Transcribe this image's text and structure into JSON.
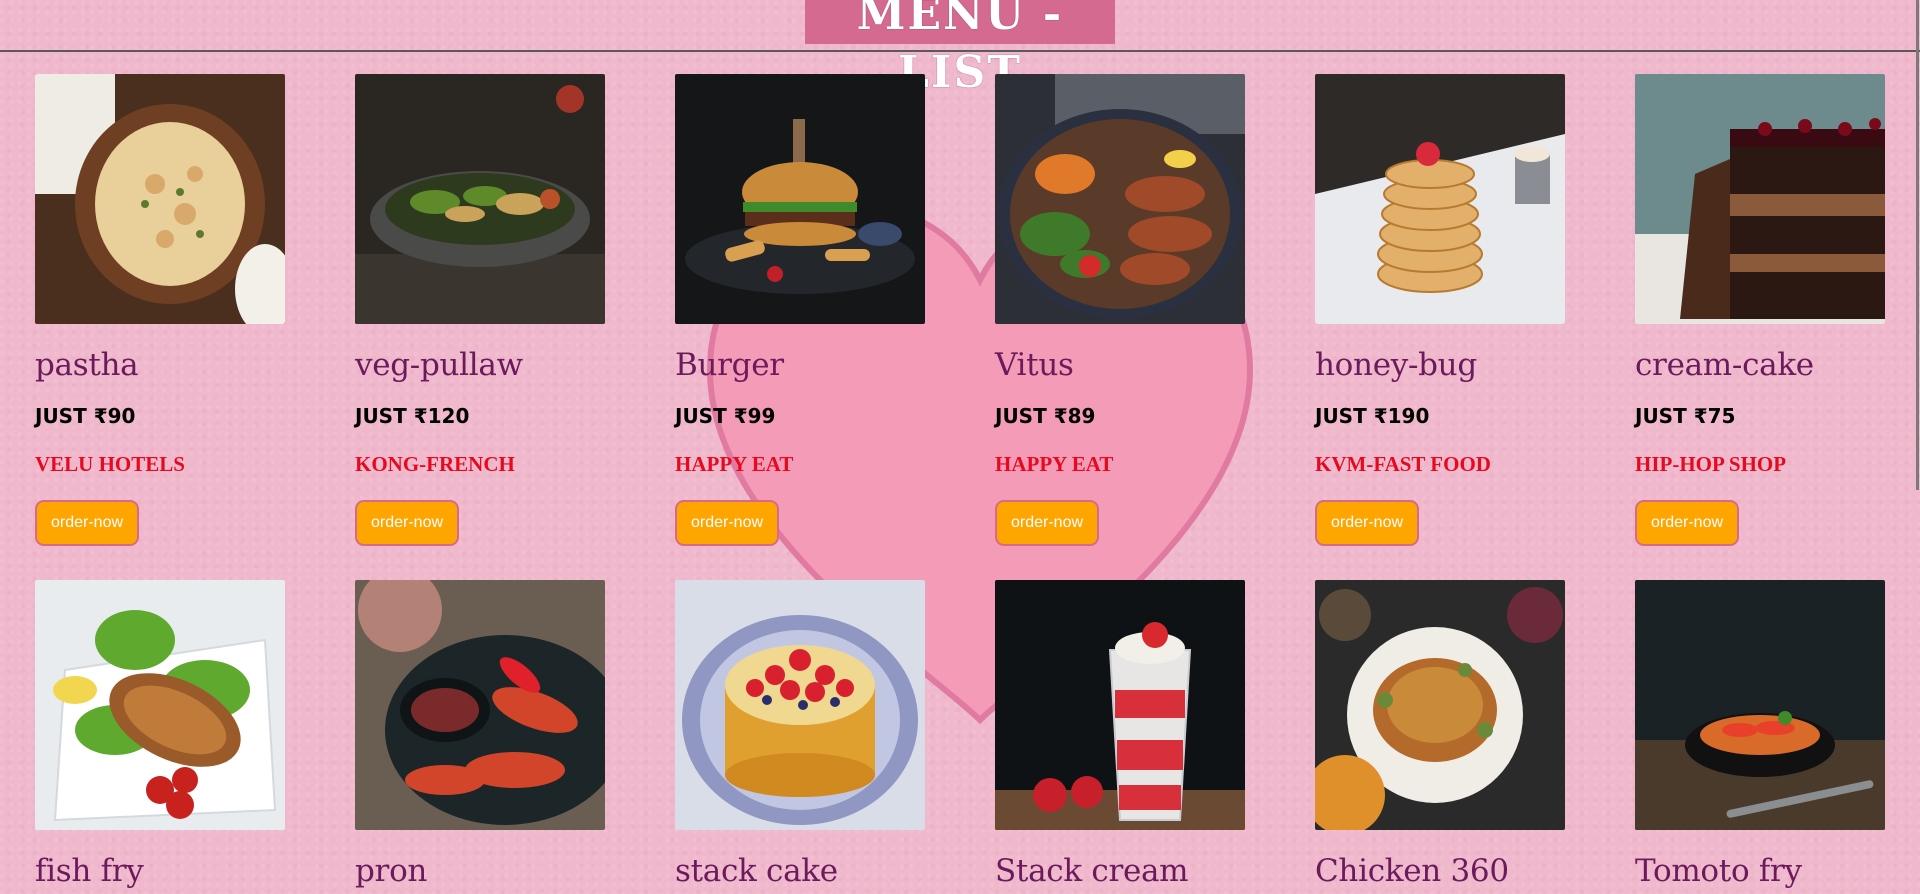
{
  "header": {
    "title": "MENU - LIST"
  },
  "menu": {
    "items": [
      {
        "name": "pastha",
        "price": "JUST ₹90",
        "shop": "VELU HOTELS",
        "button": "order-now"
      },
      {
        "name": "veg-pullaw",
        "price": "JUST ₹120",
        "shop": "KONG-FRENCH",
        "button": "order-now"
      },
      {
        "name": "Burger",
        "price": "JUST ₹99",
        "shop": "HAPPY EAT",
        "button": "order-now"
      },
      {
        "name": "Vitus",
        "price": "JUST ₹89",
        "shop": "HAPPY EAT",
        "button": "order-now"
      },
      {
        "name": "honey-bug",
        "price": "JUST ₹190",
        "shop": "KVM-FAST FOOD",
        "button": "order-now"
      },
      {
        "name": "cream-cake",
        "price": "JUST ₹75",
        "shop": "HIP-HOP SHOP",
        "button": "order-now"
      },
      {
        "name": "fish fry"
      },
      {
        "name": "pron"
      },
      {
        "name": "stack cake"
      },
      {
        "name": "Stack cream"
      },
      {
        "name": "Chicken 360"
      },
      {
        "name": "Tomoto fry"
      }
    ]
  },
  "colors": {
    "background": "#f0b8cc",
    "title_bg": "#d56a91",
    "dish_name": "#6b1a5c",
    "shop_name": "#e8091e",
    "button_bg": "#ffa500",
    "button_border": "#d66a8b"
  }
}
